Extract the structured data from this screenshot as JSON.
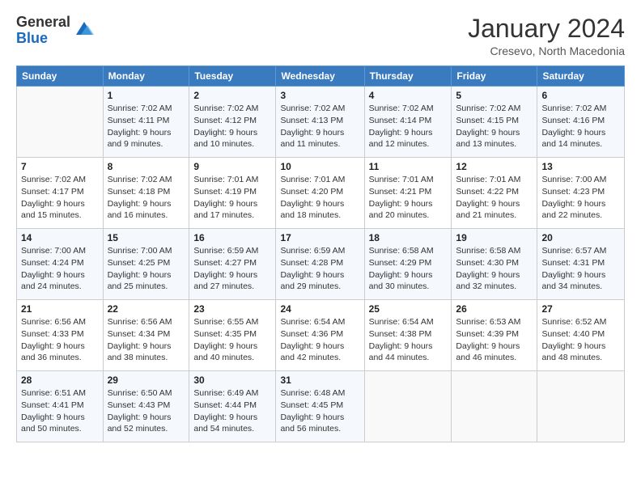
{
  "header": {
    "logo_general": "General",
    "logo_blue": "Blue",
    "month_title": "January 2024",
    "subtitle": "Cresevo, North Macedonia"
  },
  "days_of_week": [
    "Sunday",
    "Monday",
    "Tuesday",
    "Wednesday",
    "Thursday",
    "Friday",
    "Saturday"
  ],
  "weeks": [
    [
      {
        "day": "",
        "sunrise": "",
        "sunset": "",
        "daylight": ""
      },
      {
        "day": "1",
        "sunrise": "Sunrise: 7:02 AM",
        "sunset": "Sunset: 4:11 PM",
        "daylight": "Daylight: 9 hours and 9 minutes."
      },
      {
        "day": "2",
        "sunrise": "Sunrise: 7:02 AM",
        "sunset": "Sunset: 4:12 PM",
        "daylight": "Daylight: 9 hours and 10 minutes."
      },
      {
        "day": "3",
        "sunrise": "Sunrise: 7:02 AM",
        "sunset": "Sunset: 4:13 PM",
        "daylight": "Daylight: 9 hours and 11 minutes."
      },
      {
        "day": "4",
        "sunrise": "Sunrise: 7:02 AM",
        "sunset": "Sunset: 4:14 PM",
        "daylight": "Daylight: 9 hours and 12 minutes."
      },
      {
        "day": "5",
        "sunrise": "Sunrise: 7:02 AM",
        "sunset": "Sunset: 4:15 PM",
        "daylight": "Daylight: 9 hours and 13 minutes."
      },
      {
        "day": "6",
        "sunrise": "Sunrise: 7:02 AM",
        "sunset": "Sunset: 4:16 PM",
        "daylight": "Daylight: 9 hours and 14 minutes."
      }
    ],
    [
      {
        "day": "7",
        "sunrise": "Sunrise: 7:02 AM",
        "sunset": "Sunset: 4:17 PM",
        "daylight": "Daylight: 9 hours and 15 minutes."
      },
      {
        "day": "8",
        "sunrise": "Sunrise: 7:02 AM",
        "sunset": "Sunset: 4:18 PM",
        "daylight": "Daylight: 9 hours and 16 minutes."
      },
      {
        "day": "9",
        "sunrise": "Sunrise: 7:01 AM",
        "sunset": "Sunset: 4:19 PM",
        "daylight": "Daylight: 9 hours and 17 minutes."
      },
      {
        "day": "10",
        "sunrise": "Sunrise: 7:01 AM",
        "sunset": "Sunset: 4:20 PM",
        "daylight": "Daylight: 9 hours and 18 minutes."
      },
      {
        "day": "11",
        "sunrise": "Sunrise: 7:01 AM",
        "sunset": "Sunset: 4:21 PM",
        "daylight": "Daylight: 9 hours and 20 minutes."
      },
      {
        "day": "12",
        "sunrise": "Sunrise: 7:01 AM",
        "sunset": "Sunset: 4:22 PM",
        "daylight": "Daylight: 9 hours and 21 minutes."
      },
      {
        "day": "13",
        "sunrise": "Sunrise: 7:00 AM",
        "sunset": "Sunset: 4:23 PM",
        "daylight": "Daylight: 9 hours and 22 minutes."
      }
    ],
    [
      {
        "day": "14",
        "sunrise": "Sunrise: 7:00 AM",
        "sunset": "Sunset: 4:24 PM",
        "daylight": "Daylight: 9 hours and 24 minutes."
      },
      {
        "day": "15",
        "sunrise": "Sunrise: 7:00 AM",
        "sunset": "Sunset: 4:25 PM",
        "daylight": "Daylight: 9 hours and 25 minutes."
      },
      {
        "day": "16",
        "sunrise": "Sunrise: 6:59 AM",
        "sunset": "Sunset: 4:27 PM",
        "daylight": "Daylight: 9 hours and 27 minutes."
      },
      {
        "day": "17",
        "sunrise": "Sunrise: 6:59 AM",
        "sunset": "Sunset: 4:28 PM",
        "daylight": "Daylight: 9 hours and 29 minutes."
      },
      {
        "day": "18",
        "sunrise": "Sunrise: 6:58 AM",
        "sunset": "Sunset: 4:29 PM",
        "daylight": "Daylight: 9 hours and 30 minutes."
      },
      {
        "day": "19",
        "sunrise": "Sunrise: 6:58 AM",
        "sunset": "Sunset: 4:30 PM",
        "daylight": "Daylight: 9 hours and 32 minutes."
      },
      {
        "day": "20",
        "sunrise": "Sunrise: 6:57 AM",
        "sunset": "Sunset: 4:31 PM",
        "daylight": "Daylight: 9 hours and 34 minutes."
      }
    ],
    [
      {
        "day": "21",
        "sunrise": "Sunrise: 6:56 AM",
        "sunset": "Sunset: 4:33 PM",
        "daylight": "Daylight: 9 hours and 36 minutes."
      },
      {
        "day": "22",
        "sunrise": "Sunrise: 6:56 AM",
        "sunset": "Sunset: 4:34 PM",
        "daylight": "Daylight: 9 hours and 38 minutes."
      },
      {
        "day": "23",
        "sunrise": "Sunrise: 6:55 AM",
        "sunset": "Sunset: 4:35 PM",
        "daylight": "Daylight: 9 hours and 40 minutes."
      },
      {
        "day": "24",
        "sunrise": "Sunrise: 6:54 AM",
        "sunset": "Sunset: 4:36 PM",
        "daylight": "Daylight: 9 hours and 42 minutes."
      },
      {
        "day": "25",
        "sunrise": "Sunrise: 6:54 AM",
        "sunset": "Sunset: 4:38 PM",
        "daylight": "Daylight: 9 hours and 44 minutes."
      },
      {
        "day": "26",
        "sunrise": "Sunrise: 6:53 AM",
        "sunset": "Sunset: 4:39 PM",
        "daylight": "Daylight: 9 hours and 46 minutes."
      },
      {
        "day": "27",
        "sunrise": "Sunrise: 6:52 AM",
        "sunset": "Sunset: 4:40 PM",
        "daylight": "Daylight: 9 hours and 48 minutes."
      }
    ],
    [
      {
        "day": "28",
        "sunrise": "Sunrise: 6:51 AM",
        "sunset": "Sunset: 4:41 PM",
        "daylight": "Daylight: 9 hours and 50 minutes."
      },
      {
        "day": "29",
        "sunrise": "Sunrise: 6:50 AM",
        "sunset": "Sunset: 4:43 PM",
        "daylight": "Daylight: 9 hours and 52 minutes."
      },
      {
        "day": "30",
        "sunrise": "Sunrise: 6:49 AM",
        "sunset": "Sunset: 4:44 PM",
        "daylight": "Daylight: 9 hours and 54 minutes."
      },
      {
        "day": "31",
        "sunrise": "Sunrise: 6:48 AM",
        "sunset": "Sunset: 4:45 PM",
        "daylight": "Daylight: 9 hours and 56 minutes."
      },
      {
        "day": "",
        "sunrise": "",
        "sunset": "",
        "daylight": ""
      },
      {
        "day": "",
        "sunrise": "",
        "sunset": "",
        "daylight": ""
      },
      {
        "day": "",
        "sunrise": "",
        "sunset": "",
        "daylight": ""
      }
    ]
  ]
}
